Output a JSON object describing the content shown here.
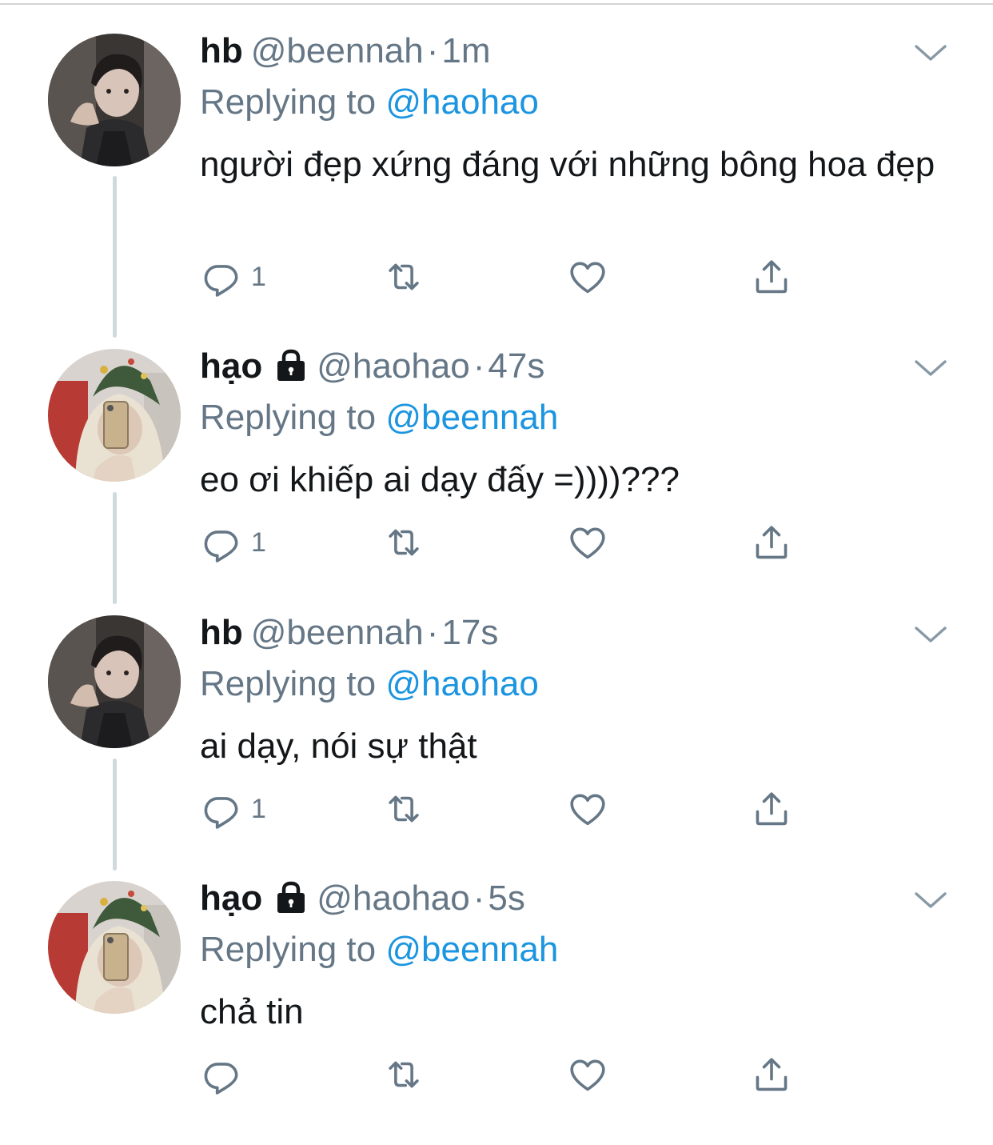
{
  "tweets": [
    {
      "name": "hb",
      "locked": false,
      "handle": "@beennah",
      "dot": "·",
      "time": "1m",
      "replying_prefix": "Replying to ",
      "replying_to": "@haohao",
      "text": "người đẹp xứng đáng với những bông hoa đẹp",
      "reply_count": "1",
      "avatar": "male-portrait-dark"
    },
    {
      "name": "hạo",
      "locked": true,
      "handle": "@haohao",
      "dot": "·",
      "time": "47s",
      "replying_prefix": "Replying to ",
      "replying_to": "@beennah",
      "text": "eo ơi khiếp ai dạy đấy =))))???",
      "reply_count": "1",
      "avatar": "hooded-selfie-christmas-tree"
    },
    {
      "name": "hb",
      "locked": false,
      "handle": "@beennah",
      "dot": "·",
      "time": "17s",
      "replying_prefix": "Replying to ",
      "replying_to": "@haohao",
      "text": "ai dạy, nói sự thật",
      "reply_count": "1",
      "avatar": "male-portrait-dark"
    },
    {
      "name": "hạo",
      "locked": true,
      "handle": "@haohao",
      "dot": "·",
      "time": "5s",
      "replying_prefix": "Replying to ",
      "replying_to": "@beennah",
      "text": "chả tin",
      "reply_count": "",
      "avatar": "hooded-selfie-christmas-tree"
    }
  ],
  "icons": {
    "reply": "reply-icon",
    "retweet": "retweet-icon",
    "like": "heart-icon",
    "share": "share-icon",
    "more": "chevron-down-icon",
    "lock": "lock-icon"
  },
  "colors": {
    "link": "#1b95e0",
    "secondary_text": "#657786",
    "primary_text": "#14171a",
    "thread_line": "#cfd9de"
  }
}
